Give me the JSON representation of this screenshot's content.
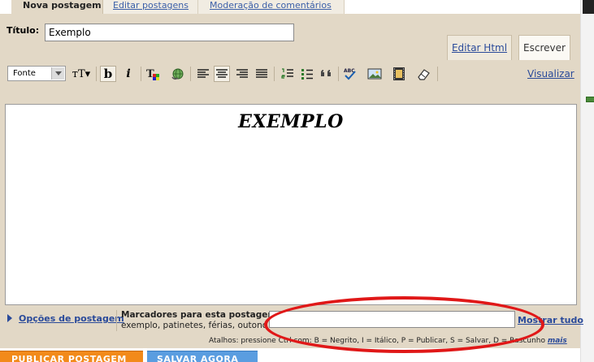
{
  "tabs": [
    {
      "label": "Nova postagem",
      "active": true
    },
    {
      "label": "Editar postagens",
      "active": false
    },
    {
      "label": "Moderação de comentários",
      "active": false
    }
  ],
  "title_field": {
    "label": "Título:",
    "value": "Exemplo"
  },
  "mode_tabs": {
    "html": "Editar Html",
    "compose": "Escrever"
  },
  "toolbar": {
    "font_select": "Fonte",
    "font_size_glyph": "тT▾",
    "bold_glyph": "b",
    "italic_glyph": "i",
    "preview": "Visualizar"
  },
  "editor": {
    "heading": "EXEMPLO"
  },
  "post_options": "Opções de postagem",
  "labels": {
    "title": "Marcadores para esta postagem:",
    "suggestions": "exemplo, patinetes, férias, outono",
    "value": "",
    "show_all": "Mostrar tudo"
  },
  "shortcuts": "Atalhos: pressione Ctrl com: B = Negrito, I = Itálico, P = Publicar, S = Salvar, D = Rascunho",
  "shortcuts_more": "mais",
  "buttons": {
    "publish": "PUBLICAR POSTAGEM",
    "save": "SALVAR AGORA"
  },
  "colors": {
    "panel": "#e2d8c6",
    "link": "#2a4a9a",
    "annotation": "#e01818",
    "publish": "#f28a1a",
    "save": "#5a9de0"
  }
}
